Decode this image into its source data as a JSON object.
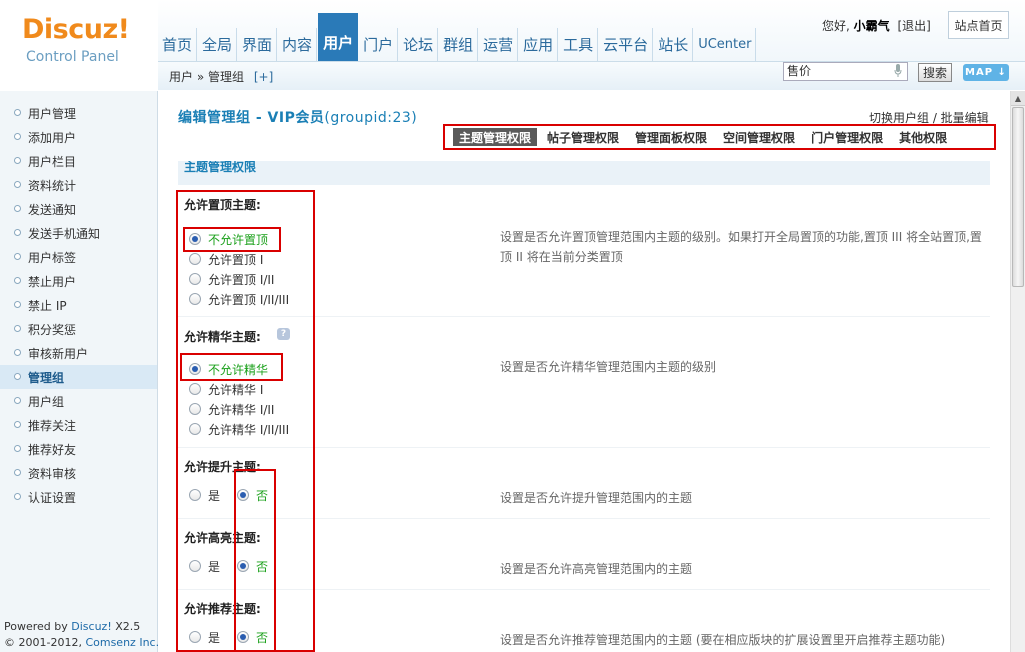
{
  "brand": {
    "logo": "Discuz!",
    "subtitle": "Control Panel"
  },
  "nav": [
    "首页",
    "全局",
    "界面",
    "内容",
    "用户",
    "门户",
    "论坛",
    "群组",
    "运营",
    "应用",
    "工具",
    "云平台",
    "站长",
    "UCenter"
  ],
  "nav_active": "用户",
  "header": {
    "greeting": "您好,",
    "username": "小霸气",
    "logout": "[退出]",
    "site_home": "站点首页"
  },
  "subbar": {
    "crumb_root": "用户",
    "crumb_sep": "»",
    "crumb_current": "管理组",
    "crumb_add": "[+]",
    "search_value": "售价",
    "search_button": "搜索",
    "map_button": "MAP ↓"
  },
  "sidebar": {
    "items": [
      "用户管理",
      "添加用户",
      "用户栏目",
      "资料统计",
      "发送通知",
      "发送手机通知",
      "用户标签",
      "禁止用户",
      "禁止 IP",
      "积分奖惩",
      "审核新用户",
      "管理组",
      "用户组",
      "推荐关注",
      "推荐好友",
      "资料审核",
      "认证设置"
    ],
    "active": "管理组",
    "powered_prefix": "Powered by ",
    "powered_brand": "Discuz!",
    "powered_version": " X2.5",
    "copyright_prefix": "© 2001-2012, ",
    "copyright_company": "Comsenz Inc."
  },
  "main": {
    "title": "编辑管理组 - VIP会员",
    "title_gid": "(groupid:23)",
    "switch_link": "切换用户组 / 批量编辑",
    "tabs": [
      "主题管理权限",
      "帖子管理权限",
      "管理面板权限",
      "空间管理权限",
      "门户管理权限",
      "其他权限"
    ],
    "active_tab": "主题管理权限",
    "section_title": "主题管理权限",
    "fields": {
      "top": {
        "label": "允许置顶主题:",
        "options": [
          "不允许置顶",
          "允许置顶 I",
          "允许置顶 I/II",
          "允许置顶 I/II/III"
        ],
        "selected": "不允许置顶",
        "desc": "设置是否允许置顶管理范围内主题的级别。如果打开全局置顶的功能,置顶 III 将全站置顶,置顶 II 将在当前分类置顶"
      },
      "digest": {
        "label": "允许精华主题:",
        "help": "?",
        "options": [
          "不允许精华",
          "允许精华 I",
          "允许精华 I/II",
          "允许精华 I/II/III"
        ],
        "selected": "不允许精华",
        "desc": "设置是否允许精华管理范围内主题的级别"
      },
      "bump": {
        "label": "允许提升主题:",
        "yes": "是",
        "no": "否",
        "selected": "否",
        "desc": "设置是否允许提升管理范围内的主题"
      },
      "highlight": {
        "label": "允许高亮主题:",
        "yes": "是",
        "no": "否",
        "selected": "否",
        "desc": "设置是否允许高亮管理范围内的主题"
      },
      "recommend": {
        "label": "允许推荐主题:",
        "yes": "是",
        "no": "否",
        "selected": "否",
        "desc": "设置是否允许推荐管理范围内的主题 (要在相应版块的扩展设置里开启推荐主题功能)"
      }
    }
  },
  "colors": {
    "brand_orange": "#f08a1c",
    "nav_blue": "#2a7ab8",
    "highlight_red": "#d90000",
    "checked_green": "#1aa01a"
  }
}
